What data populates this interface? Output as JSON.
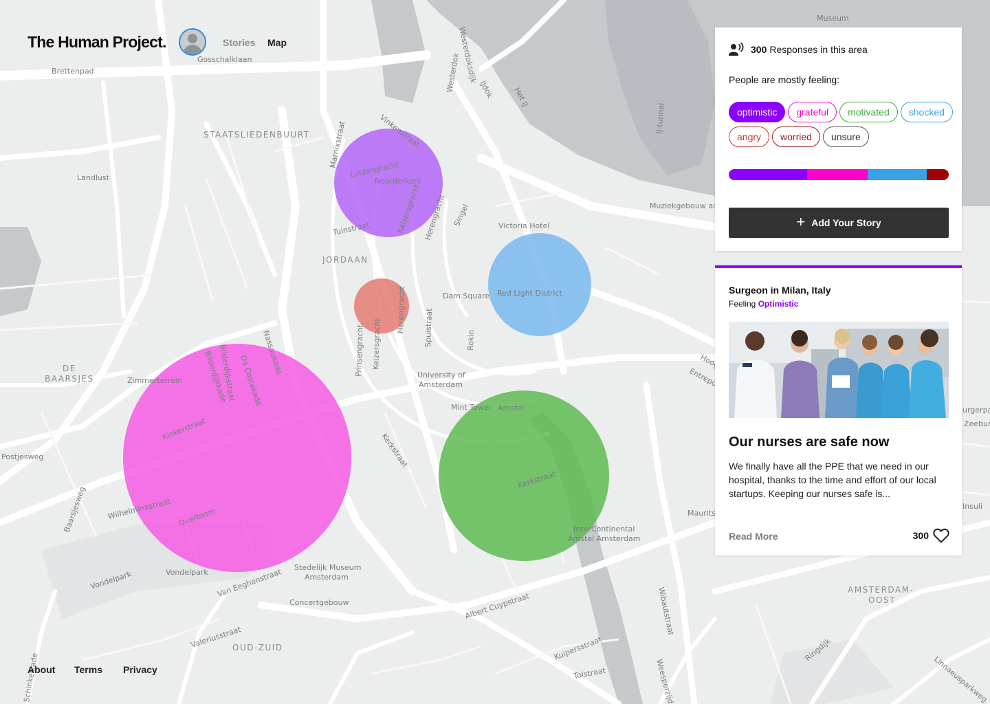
{
  "header": {
    "brand": "The Human Project.",
    "nav": [
      "Stories",
      "Map"
    ],
    "active_nav": "Map"
  },
  "summary": {
    "responses_count": "300",
    "responses_label": "Responses in this area",
    "mostly_feeling": "People are mostly feeling:",
    "emotions": [
      {
        "label": "optimistic",
        "color": "#8b00ff",
        "selected": true
      },
      {
        "label": "grateful",
        "color": "#ff00c8",
        "selected": false
      },
      {
        "label": "motivated",
        "color": "#3fae3a",
        "selected": false
      },
      {
        "label": "shocked",
        "color": "#37a2e6",
        "selected": false
      },
      {
        "label": "angry",
        "color": "#c0392b",
        "selected": false
      },
      {
        "label": "worried",
        "color": "#9b1c1c",
        "selected": false
      },
      {
        "label": "unsure",
        "color": "#555555",
        "selected": false
      }
    ],
    "breakdown": [
      {
        "emotion": "optimistic",
        "color": "#8b00ff",
        "share": 0.355
      },
      {
        "emotion": "grateful",
        "color": "#ff00c8",
        "share": 0.275
      },
      {
        "emotion": "shocked",
        "color": "#37a2e6",
        "share": 0.27
      },
      {
        "emotion": "worried",
        "color": "#a00000",
        "share": 0.1
      }
    ],
    "add_story_label": "Add Your Story"
  },
  "story": {
    "author": "Surgeon in Milan, Italy",
    "feeling_prefix": "Feeling",
    "feeling": "Optimistic",
    "accent_color": "#8b00ff",
    "title": "Our nurses are safe now",
    "excerpt": "We finally have all the PPE that we need in our hospital, thanks to the time and effort of our local startups. Keeping our nurses safe is...",
    "read_more": "Read More",
    "likes": "300"
  },
  "map": {
    "labels": {
      "gosschalklaan": "Gosschalklaan",
      "brettenpad": "Brettenpad",
      "staatsliedenbuurt": "STAATSLIEDENBUURT",
      "landlust": "Landlust",
      "marnixstraat": "Marnixstraat",
      "vinkenstraat": "Vinkenstraat",
      "lindengracht": "Lindengracht",
      "noorderkerk": "Noorderkerk",
      "keizersgracht": "Keizersgracht",
      "herengracht": "Herengracht",
      "singel": "Singel",
      "tuinstraat": "Tuinstraat",
      "jordaan": "JORDAAN",
      "victoria_hotel": "Victoria Hotel",
      "muziekgebouw": "Muziekgebouw aan",
      "dam_square": "Dam Square",
      "red_light": "Red Light District",
      "rokin": "Rokin",
      "spuistraat": "Spuistraat",
      "prinsengracht": "Prinsengracht",
      "university": "University of",
      "amsterdam": "Amsterdam",
      "mint_tower": "Mint Tower",
      "amstel": "Amstel",
      "de": "DE",
      "baarsjes": "BAARSJES",
      "zimmerterrein": "Zimmerterrein",
      "bilderdijkstraat": "Bilderdijkstraat",
      "bilderdijkkade": "Bilderdijkkade",
      "da_costakade": "Da Costakade",
      "nassaukade": "Nassaukade",
      "kinkerstraat": "Kinkerstraat",
      "postjesweg": "Postjesweg",
      "baarsjesweg": "Baarsjesweg",
      "wilhelminastraat": "Wilhelminastraat",
      "overtoom": "Overtoom",
      "kerkstraat": "Kerkstraat",
      "intercontinental": "InterContinental",
      "amstel_amsterdam": "Amstel Amsterdam",
      "vondelpark": "Vondelpark",
      "stedelijk": "Stedelijk Museum",
      "stedelijk2": "Amsterdam",
      "van_eeghenstraat": "Van Eeghenstraat",
      "concertgebouw": "Concertgebouw",
      "albert_cuypstraat": "Albert Cuypstraat",
      "valeriusstraat": "Valeriusstraat",
      "oud_zuid": "OUD-ZUID",
      "amsterdam_oost": "AMSTERDAM-",
      "oost": "OOST",
      "wibautstraat": "Wibautstraat",
      "kuipersstraat": "Kuipersstraat",
      "tolstraat": "Tolstraat",
      "ringdijk": "Ringdijk",
      "westerdoksdijk": "Westerdoksdijk",
      "het_ij": "Het IJ",
      "ij_tunnel": "IJ-tunnel",
      "museum": "Museum",
      "mauritskade": "Maurits",
      "hoog": "Hoog",
      "entrepot": "Entrepo",
      "insulinde": "Insuli",
      "weesperzijde": "Weesperzijde",
      "linnaeusparkweg": "Linnaeusparkweg",
      "schinkelkade": "Schinkelkade",
      "westerdok": "Westerdok",
      "ijdok": "IJdok",
      "zeeburg": "Zeeburg",
      "burgerpark": "urgerpar"
    },
    "circles": [
      {
        "emotion": "optimistic",
        "color": "#b565f7"
      },
      {
        "emotion": "shocked",
        "color": "#7ab9ee"
      },
      {
        "emotion": "angry",
        "color": "#e47a72"
      },
      {
        "emotion": "grateful",
        "color": "#f75be4"
      },
      {
        "emotion": "motivated",
        "color": "#5fba52"
      }
    ]
  },
  "footer": {
    "about": "About",
    "terms": "Terms",
    "privacy": "Privacy"
  }
}
